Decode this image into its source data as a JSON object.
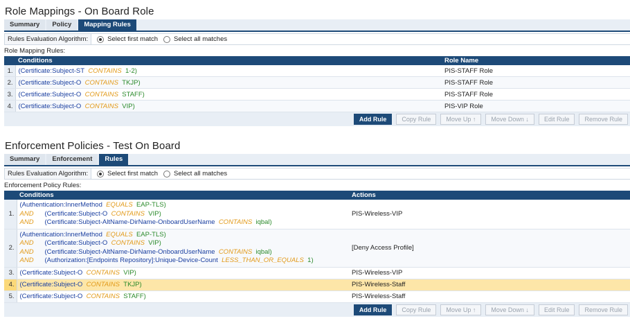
{
  "section1": {
    "title": "Role Mappings - On Board Role",
    "tabs": [
      "Summary",
      "Policy",
      "Mapping Rules"
    ],
    "algo_label": "Rules Evaluation Algorithm:",
    "opt_first": "Select first match",
    "opt_all": "Select all matches",
    "sublabel": "Role Mapping Rules:",
    "col_conditions": "Conditions",
    "col_role": "Role Name",
    "rows": [
      {
        "num": "1.",
        "attr": "(Certificate:Subject-ST",
        "op": "CONTAINS",
        "val": "1-2)",
        "role": "PIS-STAFF Role"
      },
      {
        "num": "2.",
        "attr": "(Certificate:Subject-O",
        "op": "CONTAINS",
        "val": "TKJP)",
        "role": "PIS-STAFF Role"
      },
      {
        "num": "3.",
        "attr": "(Certificate:Subject-O",
        "op": "CONTAINS",
        "val": "STAFF)",
        "role": "PIS-STAFF Role"
      },
      {
        "num": "4.",
        "attr": "(Certificate:Subject-O",
        "op": "CONTAINS",
        "val": "VIP)",
        "role": "PIS-VIP Role"
      }
    ],
    "buttons": [
      "Add Rule",
      "Copy Rule",
      "Move Up ↑",
      "Move Down ↓",
      "Edit Rule",
      "Remove Rule"
    ]
  },
  "section2": {
    "title": "Enforcement Policies - Test On Board",
    "tabs": [
      "Summary",
      "Enforcement",
      "Rules"
    ],
    "algo_label": "Rules Evaluation Algorithm:",
    "opt_first": "Select first match",
    "opt_all": "Select all matches",
    "sublabel": "Enforcement Policy Rules:",
    "col_conditions": "Conditions",
    "col_actions": "Actions",
    "and": "AND",
    "r1": {
      "num": "1.",
      "l1a": "(Authentication:InnerMethod",
      "l1o": "EQUALS",
      "l1v": "EAP-TLS)",
      "l2a": "(Certificate:Subject-O",
      "l2o": "CONTAINS",
      "l2v": "VIP)",
      "l3a": "(Certificate:Subject-AltName-DirName-OnboardUserName",
      "l3o": "CONTAINS",
      "l3v": "iqbal)",
      "action": "PIS-Wireless-VIP"
    },
    "r2": {
      "num": "2.",
      "l1a": "(Authentication:InnerMethod",
      "l1o": "EQUALS",
      "l1v": "EAP-TLS)",
      "l2a": "(Certificate:Subject-O",
      "l2o": "CONTAINS",
      "l2v": "VIP)",
      "l3a": "(Certificate:Subject-AltName-DirName-OnboardUserName",
      "l3o": "CONTAINS",
      "l3v": "iqbal)",
      "l4a": "(Authorization:[Endpoints Repository]:Unique-Device-Count",
      "l4o": "LESS_THAN_OR_EQUALS",
      "l4v": "1)",
      "action": "[Deny Access Profile]"
    },
    "r3": {
      "num": "3.",
      "attr": "(Certificate:Subject-O",
      "op": "CONTAINS",
      "val": "VIP)",
      "action": "PIS-Wireless-VIP"
    },
    "r4": {
      "num": "4.",
      "attr": "(Certificate:Subject-O",
      "op": "CONTAINS",
      "val": "TKJP)",
      "action": "PIS-Wireless-Staff"
    },
    "r5": {
      "num": "5.",
      "attr": "(Certificate:Subject-O",
      "op": "CONTAINS",
      "val": "STAFF)",
      "action": "PIS-Wireless-Staff"
    },
    "buttons": [
      "Add Rule",
      "Copy Rule",
      "Move Up ↑",
      "Move Down ↓",
      "Edit Rule",
      "Remove Rule"
    ]
  },
  "colors": {
    "header": "#1d4a78",
    "attr": "#1a3fa0",
    "operator": "#e29a19",
    "value": "#2b8a2b",
    "highlight": "#fde6a8"
  }
}
